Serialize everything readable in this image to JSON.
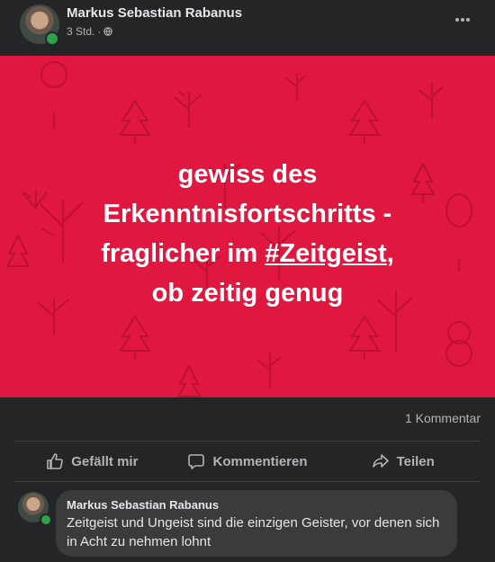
{
  "post": {
    "author": "Markus Sebastian Rabanus",
    "time": "3 Std.",
    "separator": "·",
    "image_text_lines": [
      "gewiss des",
      "Erkenntnisfortschritts -",
      "fraglicher im "
    ],
    "hashtag": "#Zeitgeist",
    "line3_suffix": ",",
    "last_line": "ob zeitig genug",
    "comment_count": "1 Kommentar",
    "colors": {
      "image_bg": "#e0173f",
      "card_bg": "#242526",
      "online": "#31a24c"
    }
  },
  "actions": {
    "like": "Gefällt mir",
    "comment": "Kommentieren",
    "share": "Teilen"
  },
  "comment": {
    "author": "Markus Sebastian Rabanus",
    "text": "Zeitgeist und Ungeist sind die einzigen Geister, vor denen sich in Acht zu nehmen lohnt"
  },
  "icons": [
    "globe-icon",
    "more-options-icon",
    "like-icon",
    "comment-icon",
    "share-icon"
  ]
}
